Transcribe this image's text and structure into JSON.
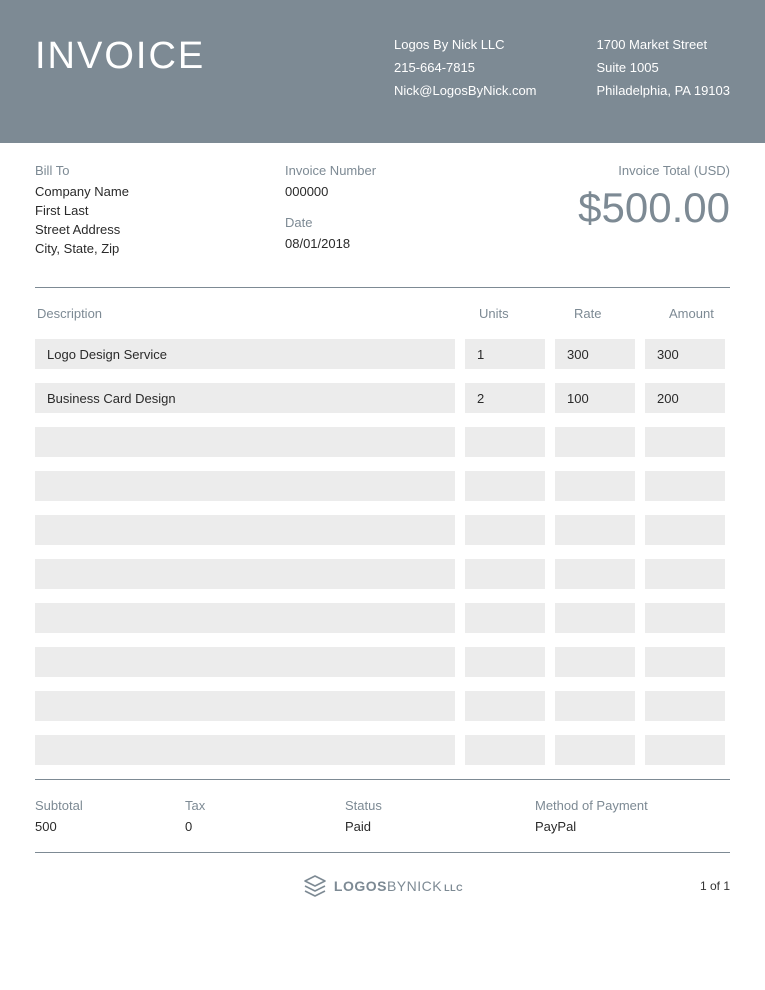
{
  "header": {
    "title": "INVOICE",
    "company": {
      "name": "Logos By Nick LLC",
      "phone": "215-664-7815",
      "email": "Nick@LogosByNick.com"
    },
    "address": {
      "street": "1700 Market Street",
      "suite": "Suite 1005",
      "city": "Philadelphia, PA 19103"
    }
  },
  "bill_to": {
    "label": "Bill To",
    "company": "Company Name",
    "name": "First Last",
    "street": "Street Address",
    "city": "City, State, Zip"
  },
  "invoice_number": {
    "label": "Invoice Number",
    "value": "000000"
  },
  "date": {
    "label": "Date",
    "value": "08/01/2018"
  },
  "total": {
    "label": "Invoice Total (USD)",
    "value": "$500.00"
  },
  "columns": {
    "description": "Description",
    "units": "Units",
    "rate": "Rate",
    "amount": "Amount"
  },
  "items": [
    {
      "description": "Logo Design Service",
      "units": "1",
      "rate": "300",
      "amount": "300"
    },
    {
      "description": "Business Card Design",
      "units": "2",
      "rate": "100",
      "amount": "200"
    },
    {
      "description": "",
      "units": "",
      "rate": "",
      "amount": ""
    },
    {
      "description": "",
      "units": "",
      "rate": "",
      "amount": ""
    },
    {
      "description": "",
      "units": "",
      "rate": "",
      "amount": ""
    },
    {
      "description": "",
      "units": "",
      "rate": "",
      "amount": ""
    },
    {
      "description": "",
      "units": "",
      "rate": "",
      "amount": ""
    },
    {
      "description": "",
      "units": "",
      "rate": "",
      "amount": ""
    },
    {
      "description": "",
      "units": "",
      "rate": "",
      "amount": ""
    },
    {
      "description": "",
      "units": "",
      "rate": "",
      "amount": ""
    }
  ],
  "summary": {
    "subtotal": {
      "label": "Subtotal",
      "value": "500"
    },
    "tax": {
      "label": "Tax",
      "value": "0"
    },
    "status": {
      "label": "Status",
      "value": "Paid"
    },
    "payment": {
      "label": "Method of Payment",
      "value": "PayPal"
    }
  },
  "footer": {
    "logo_bold": "LOGOS",
    "logo_light": "BYNICK",
    "logo_llc": "LLC",
    "page": "1 of 1"
  }
}
